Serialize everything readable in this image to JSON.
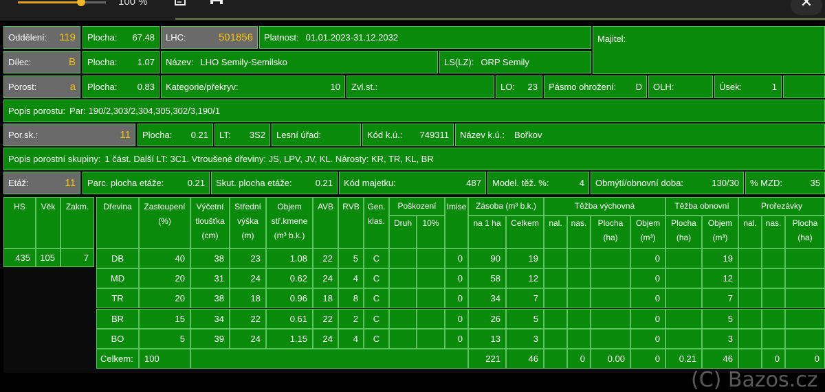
{
  "toolbar": {
    "zoom": "100 %",
    "zoom_fraction": 0.72,
    "icons": [
      "edit-icon",
      "print-icon",
      "close-icon"
    ]
  },
  "header": {
    "oddeleni_label": "Oddělení:",
    "oddeleni": "119",
    "plocha1_label": "Plocha:",
    "plocha1": "67.48",
    "lhc_label": "LHC:",
    "lhc": "501856",
    "platnost_label": "Platnost:",
    "platnost": "01.01.2023-31.12.2032",
    "majitel_label": "Majitel:",
    "dilec_label": "Dílec:",
    "dilec": "B",
    "plocha2_label": "Plocha:",
    "plocha2": "1.07",
    "nazev_label": "Název:",
    "nazev": "LHO Semily-Semilsko",
    "ls_label": "LS(LZ):",
    "ls": "ORP Semily",
    "porost_label": "Porost:",
    "porost": "a",
    "plocha3_label": "Plocha:",
    "plocha3": "0.83",
    "kategorie_label": "Kategorie/překryv:",
    "kategorie": "10",
    "zvlst_label": "Zvl.st.:",
    "lo_label": "LO:",
    "lo": "23",
    "pasmo_label": "Pásmo ohrožení:",
    "pasmo": "D",
    "olh_label": "OLH:",
    "usek_label": "Úsek:",
    "usek": "1",
    "popis_porostu_label": "Popis porostu:",
    "popis_porostu": "Par: 190/2,303/2,304,305,302/3,190/1",
    "porsk_label": "Por.sk.:",
    "porsk": "11",
    "plocha4_label": "Plocha:",
    "plocha4": "0.21",
    "lt_label": "LT:",
    "lt": "3S2",
    "lesni_urad_label": "Lesní úřad:",
    "kodku_label": "Kód k.ú.:",
    "kodku": "749311",
    "nazevku_label": "Název k.ú.:",
    "nazevku": "Bořkov",
    "popis_skupiny_label": "Popis porostní skupiny:",
    "popis_skupiny": "1 část. Další LT: 3C1. Vtroušené dřeviny: JS, LPV, JV, KL. Nárosty: KR, TR, KL, BR",
    "etaz_label": "Etáž:",
    "etaz": "11",
    "parc_label": "Parc. plocha etáže:",
    "parc": "0.21",
    "skut_label": "Skut. plocha etáže:",
    "skut": "0.21",
    "kodmaj_label": "Kód majetku:",
    "kodmaj": "487",
    "model_label": "Model. těž. %:",
    "model": "4",
    "obmyti_label": "Obmýtí/obnovní doba:",
    "obmyti": "130/30",
    "mzd_label": "% MZD:",
    "mzd": "35"
  },
  "left_table": {
    "headers": [
      "HS",
      "Věk",
      "Zakm."
    ],
    "values": [
      "435",
      "105",
      "7"
    ]
  },
  "table": {
    "h": {
      "dreviny": "Dřevina",
      "zast": "Zastoupení",
      "zast_u": "(%)",
      "vyc1": "Výčetní",
      "vyc2": "tloušťka",
      "vyc3": "(cm)",
      "str1": "Střední",
      "str2": "výška",
      "str3": "(m)",
      "obj1": "Objem",
      "obj2": "stř.kmene",
      "obj3": "(m³ b.k.)",
      "avb": "AVB",
      "rvb": "RVB",
      "gen1": "Gen.",
      "gen2": "klas.",
      "posk": "Poškození",
      "druh": "Druh",
      "p10": "10%",
      "imise": "Imise",
      "zasoba": "Zásoba (m³ b.k.)",
      "na1ha": "na 1 ha",
      "celkem": "Celkem",
      "tv": "Těžba výchovná",
      "to": "Těžba obnovní",
      "pr": "Prořezávky",
      "nal": "nal.",
      "nas": "nas.",
      "plocha": "Plocha",
      "ha": "(ha)",
      "objem": "Objem",
      "m3": "(m³)"
    },
    "rows": [
      {
        "dr": "DB",
        "zast": "40",
        "vyc": "38",
        "str": "23",
        "obj": "1.08",
        "avb": "22",
        "rvb": "5",
        "gen": "C",
        "imise": "0",
        "na1ha": "90",
        "celkem": "19",
        "tv_obj": "0",
        "to_obj": "19"
      },
      {
        "dr": "MD",
        "zast": "20",
        "vyc": "31",
        "str": "24",
        "obj": "0.62",
        "avb": "24",
        "rvb": "4",
        "gen": "C",
        "imise": "0",
        "na1ha": "58",
        "celkem": "12",
        "tv_obj": "0",
        "to_obj": "12"
      },
      {
        "dr": "TR",
        "zast": "20",
        "vyc": "38",
        "str": "18",
        "obj": "0.96",
        "avb": "18",
        "rvb": "8",
        "gen": "C",
        "imise": "0",
        "na1ha": "34",
        "celkem": "7",
        "tv_obj": "0",
        "to_obj": "7"
      },
      {
        "dr": "BR",
        "zast": "15",
        "vyc": "34",
        "str": "22",
        "obj": "0.61",
        "avb": "22",
        "rvb": "2",
        "gen": "C",
        "imise": "0",
        "na1ha": "26",
        "celkem": "5",
        "tv_obj": "0",
        "to_obj": "5"
      },
      {
        "dr": "BO",
        "zast": "5",
        "vyc": "39",
        "str": "24",
        "obj": "1.15",
        "avb": "24",
        "rvb": "4",
        "gen": "C",
        "imise": "0",
        "na1ha": "13",
        "celkem": "3",
        "tv_obj": "0",
        "to_obj": "3"
      }
    ],
    "total": {
      "label": "Celkem:",
      "zast": "100",
      "na1ha": "221",
      "celkem": "46",
      "tv_nas": "0",
      "tv_plocha": "0.00",
      "tv_obj": "0",
      "to_plocha": "0.21",
      "to_obj": "46",
      "pr_nas": "0",
      "pr_plocha": "0"
    }
  },
  "watermark": "(C) Bazos.cz"
}
